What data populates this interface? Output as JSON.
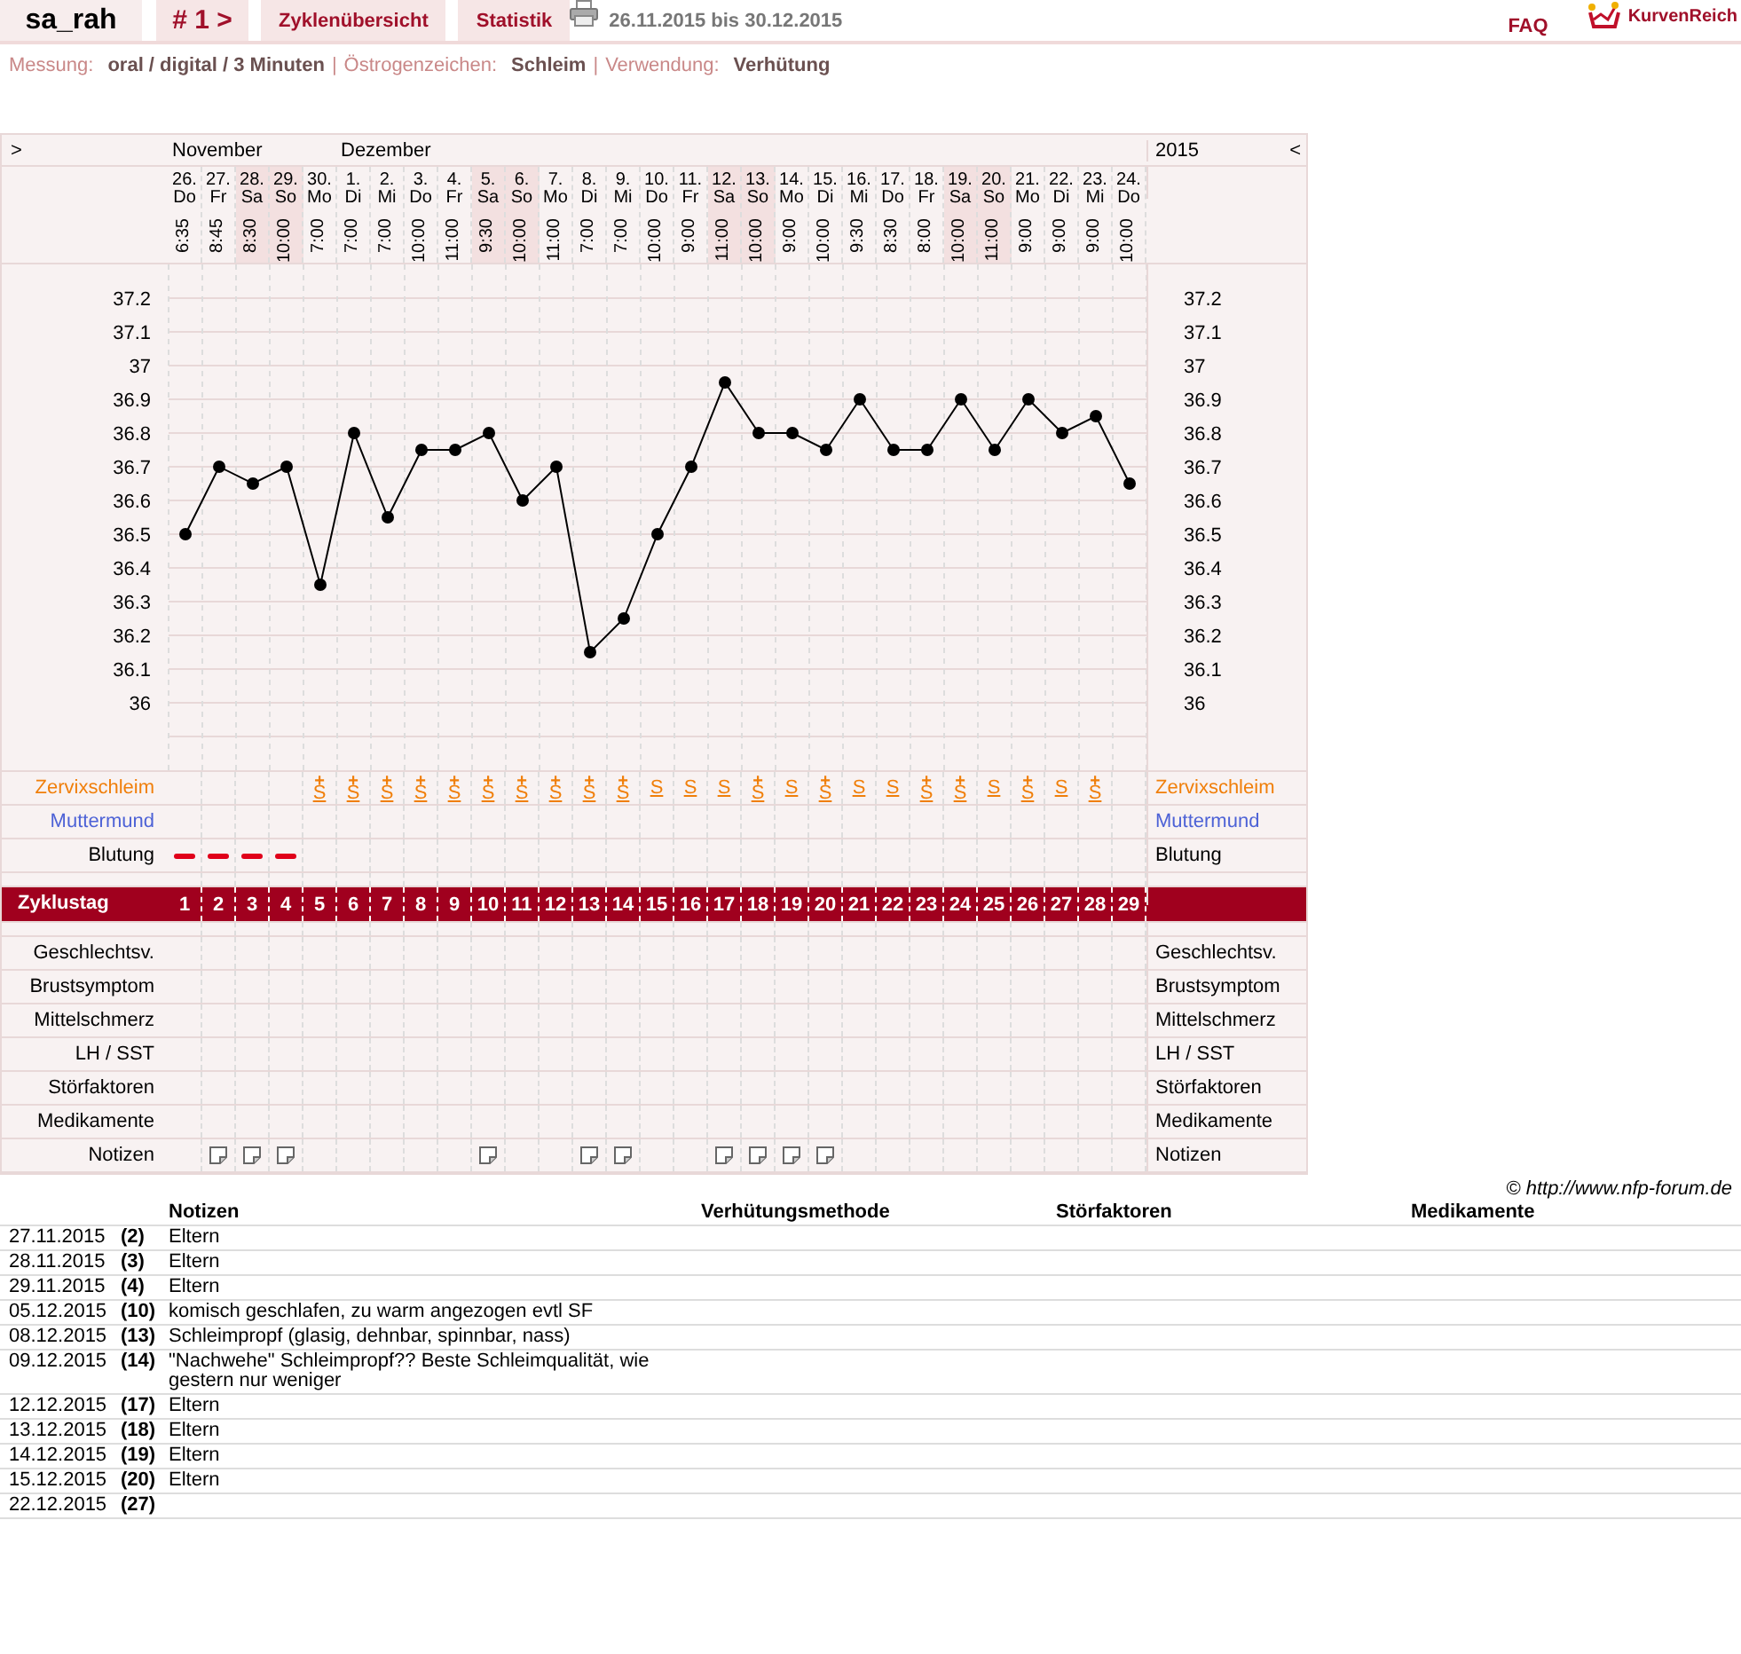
{
  "header": {
    "user": "sa_rah",
    "cycle": "# 1 >",
    "tabs": [
      {
        "label": "Zyklenübersicht"
      },
      {
        "label": "Statistik"
      }
    ],
    "range": "26.11.2015 bis 30.12.2015",
    "faq": "FAQ",
    "brand": "KurvenReich"
  },
  "info": [
    {
      "label": "Messung:",
      "value": "oral / digital / 3 Minuten"
    },
    {
      "separator": "|",
      "label": "Östrogenzeichen:",
      "value": "Schleim"
    },
    {
      "separator": "|",
      "label": "Verwendung:",
      "value": "Verhütung"
    }
  ],
  "cycle_chart": {
    "nav_left": ">",
    "nav_right": "<",
    "year": "2015",
    "right_ticks": [
      "37.2",
      "37.1",
      "37",
      "36.9",
      "36.8",
      "36.7",
      "36.6",
      "36.5",
      "36.4",
      "36.3",
      "36.2",
      "36.1",
      "36"
    ],
    "days": [
      {
        "month_label": "November",
        "date": "26.",
        "weekday": "Do",
        "time": "6:35",
        "weekend": false,
        "bleeding": true,
        "note": false,
        "cycle_day": "1"
      },
      {
        "date": "27.",
        "weekday": "Fr",
        "time": "8:45",
        "weekend": false,
        "bleeding": true,
        "note": true,
        "cycle_day": "2"
      },
      {
        "date": "28.",
        "weekday": "Sa",
        "time": "8:30",
        "weekend": true,
        "bleeding": true,
        "note": true,
        "cycle_day": "3"
      },
      {
        "date": "29.",
        "weekday": "So",
        "time": "10:00",
        "weekend": true,
        "bleeding": true,
        "note": true,
        "cycle_day": "4"
      },
      {
        "date": "30.",
        "weekday": "Mo",
        "time": "7:00",
        "weekend": false,
        "mucus": "S",
        "mucus_sign": "+",
        "bleeding": false,
        "note": false,
        "cycle_day": "5"
      },
      {
        "month_label": "Dezember",
        "date": "1.",
        "weekday": "Di",
        "time": "7:00",
        "weekend": false,
        "mucus": "S",
        "mucus_sign": "+",
        "bleeding": false,
        "note": false,
        "cycle_day": "6"
      },
      {
        "date": "2.",
        "weekday": "Mi",
        "time": "7:00",
        "weekend": false,
        "mucus": "S",
        "mucus_sign": "+",
        "bleeding": false,
        "note": false,
        "cycle_day": "7"
      },
      {
        "date": "3.",
        "weekday": "Do",
        "time": "10:00",
        "weekend": false,
        "mucus": "S",
        "mucus_sign": "+",
        "bleeding": false,
        "note": false,
        "cycle_day": "8"
      },
      {
        "date": "4.",
        "weekday": "Fr",
        "time": "11:00",
        "weekend": false,
        "mucus": "S",
        "mucus_sign": "+",
        "bleeding": false,
        "note": false,
        "cycle_day": "9"
      },
      {
        "date": "5.",
        "weekday": "Sa",
        "time": "9:30",
        "weekend": true,
        "mucus": "S",
        "mucus_sign": "+",
        "bleeding": false,
        "note": true,
        "cycle_day": "10"
      },
      {
        "date": "6.",
        "weekday": "So",
        "time": "10:00",
        "weekend": true,
        "mucus": "S",
        "mucus_sign": "+",
        "bleeding": false,
        "note": false,
        "cycle_day": "11"
      },
      {
        "date": "7.",
        "weekday": "Mo",
        "time": "11:00",
        "weekend": false,
        "mucus": "S",
        "mucus_sign": "+",
        "bleeding": false,
        "note": false,
        "cycle_day": "12"
      },
      {
        "date": "8.",
        "weekday": "Di",
        "time": "7:00",
        "weekend": false,
        "mucus": "S",
        "mucus_sign": "+",
        "bleeding": false,
        "note": true,
        "cycle_day": "13"
      },
      {
        "date": "9.",
        "weekday": "Mi",
        "time": "7:00",
        "weekend": false,
        "mucus": "S",
        "mucus_sign": "+",
        "bleeding": false,
        "note": true,
        "cycle_day": "14"
      },
      {
        "date": "10.",
        "weekday": "Do",
        "time": "10:00",
        "weekend": false,
        "mucus": "S",
        "bleeding": false,
        "note": false,
        "cycle_day": "15"
      },
      {
        "date": "11.",
        "weekday": "Fr",
        "time": "9:00",
        "weekend": false,
        "mucus": "S",
        "bleeding": false,
        "note": false,
        "cycle_day": "16"
      },
      {
        "date": "12.",
        "weekday": "Sa",
        "time": "11:00",
        "weekend": true,
        "mucus": "S",
        "bleeding": false,
        "note": true,
        "cycle_day": "17"
      },
      {
        "date": "13.",
        "weekday": "So",
        "time": "10:00",
        "weekend": true,
        "mucus": "S",
        "mucus_sign": "+",
        "bleeding": false,
        "note": true,
        "cycle_day": "18"
      },
      {
        "date": "14.",
        "weekday": "Mo",
        "time": "9:00",
        "weekend": false,
        "mucus": "S",
        "bleeding": false,
        "note": true,
        "cycle_day": "19"
      },
      {
        "date": "15.",
        "weekday": "Di",
        "time": "10:00",
        "weekend": false,
        "mucus": "S",
        "mucus_sign": "+",
        "bleeding": false,
        "note": true,
        "cycle_day": "20"
      },
      {
        "date": "16.",
        "weekday": "Mi",
        "time": "9:30",
        "weekend": false,
        "mucus": "S",
        "bleeding": false,
        "note": false,
        "cycle_day": "21"
      },
      {
        "date": "17.",
        "weekday": "Do",
        "time": "8:30",
        "weekend": false,
        "mucus": "S",
        "bleeding": false,
        "note": false,
        "cycle_day": "22"
      },
      {
        "date": "18.",
        "weekday": "Fr",
        "time": "8:00",
        "weekend": false,
        "mucus": "S",
        "mucus_sign": "+",
        "bleeding": false,
        "note": false,
        "cycle_day": "23"
      },
      {
        "date": "19.",
        "weekday": "Sa",
        "time": "10:00",
        "weekend": true,
        "mucus": "S",
        "mucus_sign": "+",
        "bleeding": false,
        "note": false,
        "cycle_day": "24"
      },
      {
        "date": "20.",
        "weekday": "So",
        "time": "11:00",
        "weekend": true,
        "mucus": "S",
        "bleeding": false,
        "note": false,
        "cycle_day": "25"
      },
      {
        "date": "21.",
        "weekday": "Mo",
        "time": "9:00",
        "weekend": false,
        "mucus": "S",
        "mucus_sign": "+",
        "bleeding": false,
        "note": false,
        "cycle_day": "26"
      },
      {
        "date": "22.",
        "weekday": "Di",
        "time": "9:00",
        "weekend": false,
        "mucus": "S",
        "bleeding": false,
        "note": false,
        "cycle_day": "27"
      },
      {
        "date": "23.",
        "weekday": "Mi",
        "time": "9:00",
        "weekend": false,
        "mucus": "S",
        "mucus_sign": "+",
        "bleeding": false,
        "note": false,
        "cycle_day": "28"
      },
      {
        "date": "24.",
        "weekday": "Do",
        "time": "10:00",
        "weekend": false,
        "bleeding": false,
        "note": false,
        "cycle_day": "29"
      }
    ],
    "chart_data": {
      "type": "line",
      "grid": true,
      "ylim": [
        35.8,
        37.3
      ],
      "yticks": [
        36,
        36.1,
        36.2,
        36.3,
        36.4,
        36.5,
        36.6,
        36.7,
        36.8,
        36.9,
        37,
        37.1,
        37.2
      ],
      "series": [
        {
          "color": "#000000",
          "marker": "circle",
          "values": [
            36.5,
            36.7,
            36.65,
            36.7,
            36.35,
            36.8,
            36.55,
            36.75,
            36.75,
            36.8,
            36.6,
            36.7,
            36.15,
            36.25,
            36.5,
            36.7,
            36.95,
            36.8,
            36.8,
            36.75,
            36.9,
            36.75,
            36.75,
            36.9,
            36.75,
            36.9,
            36.8,
            36.85,
            36.65
          ]
        }
      ]
    },
    "rows": [
      {
        "kind": "mucus",
        "label": "Zervixschleim",
        "label_right": "Zervixschleim",
        "color": "#f07f0a"
      },
      {
        "kind": "cervix",
        "label": "Muttermund",
        "label_right": "Muttermund",
        "color": "#4d62d6"
      },
      {
        "kind": "bleeding",
        "label": "Blutung",
        "label_right": "Blutung"
      },
      {
        "kind": "spacer"
      },
      {
        "kind": "cycle",
        "label": "Zyklustag"
      },
      {
        "kind": "spacer"
      },
      {
        "kind": "plain",
        "label": "Geschlechtsv.",
        "label_right": "Geschlechtsv."
      },
      {
        "kind": "plain",
        "label": "Brustsymptom",
        "label_right": "Brustsymptom"
      },
      {
        "kind": "plain",
        "label": "Mittelschmerz",
        "label_right": "Mittelschmerz"
      },
      {
        "kind": "plain",
        "label": "LH / SST",
        "label_right": "LH / SST"
      },
      {
        "kind": "plain",
        "label": "Störfaktoren",
        "label_right": "Störfaktoren"
      },
      {
        "kind": "plain",
        "label": "Medikamente",
        "label_right": "Medikamente"
      },
      {
        "kind": "notes",
        "label": "Notizen",
        "label_right": "Notizen"
      }
    ]
  },
  "copyright": "© http://www.nfp-forum.de",
  "notes_table": {
    "columns": [
      "Notizen",
      "Verhütungsmethode",
      "Störfaktoren",
      "Medikamente"
    ],
    "rows": [
      {
        "date": "27.11.2015",
        "cycle_day": "(2)",
        "note": "Eltern"
      },
      {
        "date": "28.11.2015",
        "cycle_day": "(3)",
        "note": "Eltern"
      },
      {
        "date": "29.11.2015",
        "cycle_day": "(4)",
        "note": "Eltern"
      },
      {
        "date": "05.12.2015",
        "cycle_day": "(10)",
        "note": "komisch geschlafen, zu warm angezogen evtl SF"
      },
      {
        "date": "08.12.2015",
        "cycle_day": "(13)",
        "note": "Schleimpropf (glasig, dehnbar, spinnbar, nass)"
      },
      {
        "date": "09.12.2015",
        "cycle_day": "(14)",
        "note": "\"Nachwehe\" Schleimpropf?? Beste Schleimqualität, wie gestern nur weniger"
      },
      {
        "date": "12.12.2015",
        "cycle_day": "(17)",
        "note": "Eltern"
      },
      {
        "date": "13.12.2015",
        "cycle_day": "(18)",
        "note": "Eltern"
      },
      {
        "date": "14.12.2015",
        "cycle_day": "(19)",
        "note": "Eltern"
      },
      {
        "date": "15.12.2015",
        "cycle_day": "(20)",
        "note": "Eltern"
      },
      {
        "date": "22.12.2015",
        "cycle_day": "(27)"
      }
    ]
  }
}
